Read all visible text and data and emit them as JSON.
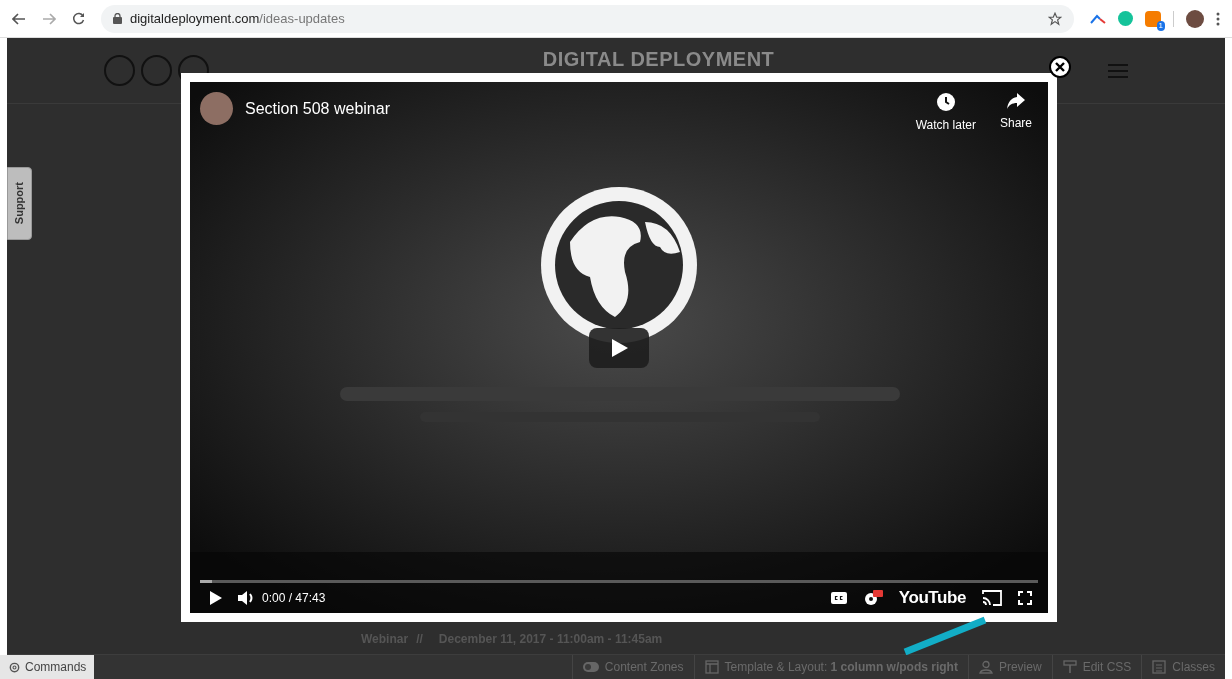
{
  "browser": {
    "url_host": "digitaldeployment.com",
    "url_path": "/ideas-updates",
    "extension_badge": "1"
  },
  "site_header": {
    "logo": "DIGITAL DEPLOYMENT"
  },
  "support_tab": "Support",
  "video": {
    "title": "Section 508 webinar",
    "actions": [
      {
        "label": "Watch later",
        "kind": "clock"
      },
      {
        "label": "Share",
        "kind": "share"
      }
    ],
    "progress": {
      "level": 0.014
    },
    "time": "0:00 / 47:43",
    "brand": "YouTube"
  },
  "event_line": {
    "type": "Webinar",
    "separator": "//",
    "date": "December 11, 2017 - 11:00am - 11:45am"
  },
  "bottom_bar": {
    "commands": "Commands",
    "items": [
      {
        "label": "Content Zones",
        "kind": "toggle"
      },
      {
        "label": "Template & Layout: **1 column w/pods right**",
        "kind": "layout"
      },
      {
        "label": "Preview",
        "kind": "person"
      },
      {
        "label": "Edit CSS",
        "kind": "brush"
      },
      {
        "label": "Classes",
        "kind": "list"
      }
    ]
  }
}
